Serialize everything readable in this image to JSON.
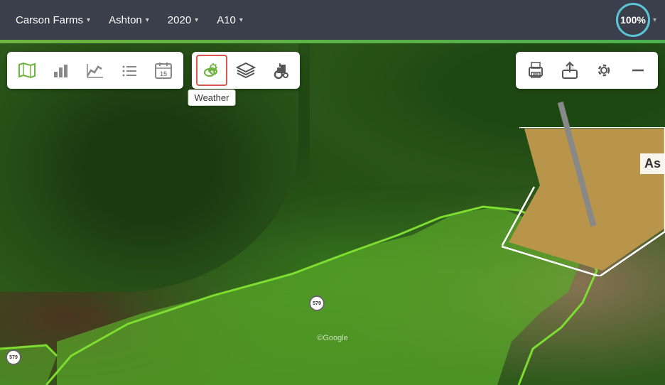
{
  "nav": {
    "farm": "Carson Farms",
    "location": "Ashton",
    "year": "2020",
    "field": "A10",
    "percent": "100%",
    "chevron": "▾"
  },
  "toolbar": {
    "map_label": "Map",
    "chart_label": "Chart",
    "graph_label": "Graph",
    "list_label": "List",
    "calendar_label": "Calendar",
    "calendar_num": "15",
    "weather_label": "Weather",
    "layers_label": "Layers",
    "equipment_label": "Equipment",
    "print_label": "Print",
    "upload_label": "Upload",
    "settings_label": "Settings"
  },
  "map": {
    "road_sign_1": "579",
    "road_sign_2": "579",
    "corner_label": "As",
    "google_watermark": "©Google"
  },
  "tooltip": {
    "weather": "Weather"
  }
}
